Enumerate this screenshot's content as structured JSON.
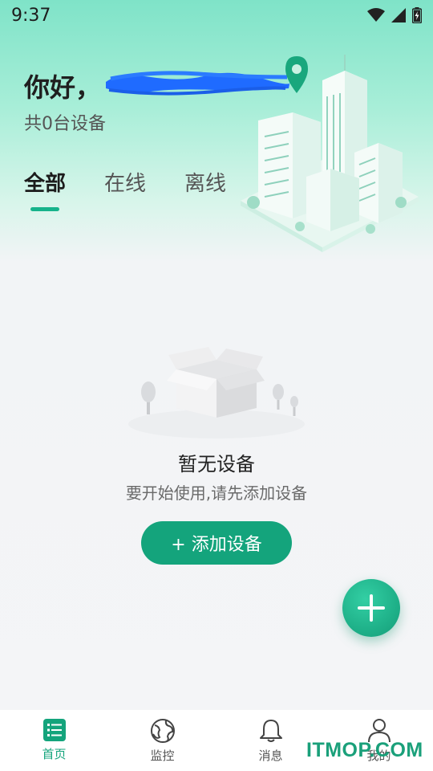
{
  "status_bar": {
    "time": "9:37",
    "icons": [
      "wifi-icon",
      "signal-icon",
      "battery-charging-icon"
    ]
  },
  "header": {
    "greeting": "你好，",
    "device_count": "共0台设备",
    "tabs": [
      {
        "label": "全部",
        "active": true
      },
      {
        "label": "在线",
        "active": false
      },
      {
        "label": "离线",
        "active": false
      }
    ]
  },
  "empty_state": {
    "title": "暂无设备",
    "subtitle": "要开始使用,请先添加设备",
    "add_button": "+ 添加设备"
  },
  "fab": {
    "icon": "plus-icon"
  },
  "bottom_nav": {
    "items": [
      {
        "label": "首页",
        "icon": "list-icon",
        "active": true
      },
      {
        "label": "监控",
        "icon": "globe-icon",
        "active": false
      },
      {
        "label": "消息",
        "icon": "bell-icon",
        "active": false
      },
      {
        "label": "我的",
        "icon": "user-icon",
        "active": false
      }
    ]
  },
  "watermark": "ITMOP.COM",
  "colors": {
    "accent": "#14a47c",
    "tab_indicator": "#16b38b",
    "redaction": "#1f6bff"
  }
}
